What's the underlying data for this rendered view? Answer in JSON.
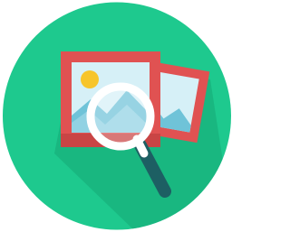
{
  "icon": {
    "name": "image-search-icon",
    "colors": {
      "circle": "#1ec98e",
      "long_shadow": "#16a874",
      "photo_frame": "#e05252",
      "photo_frame_shade": "#c94545",
      "sky": "#d6f0f7",
      "mountain": "#6fc3d8",
      "mountain_light": "#9fd9e8",
      "sun": "#f7c52b",
      "lens_ring": "#ffffff",
      "handle": "#1d5f63"
    }
  }
}
